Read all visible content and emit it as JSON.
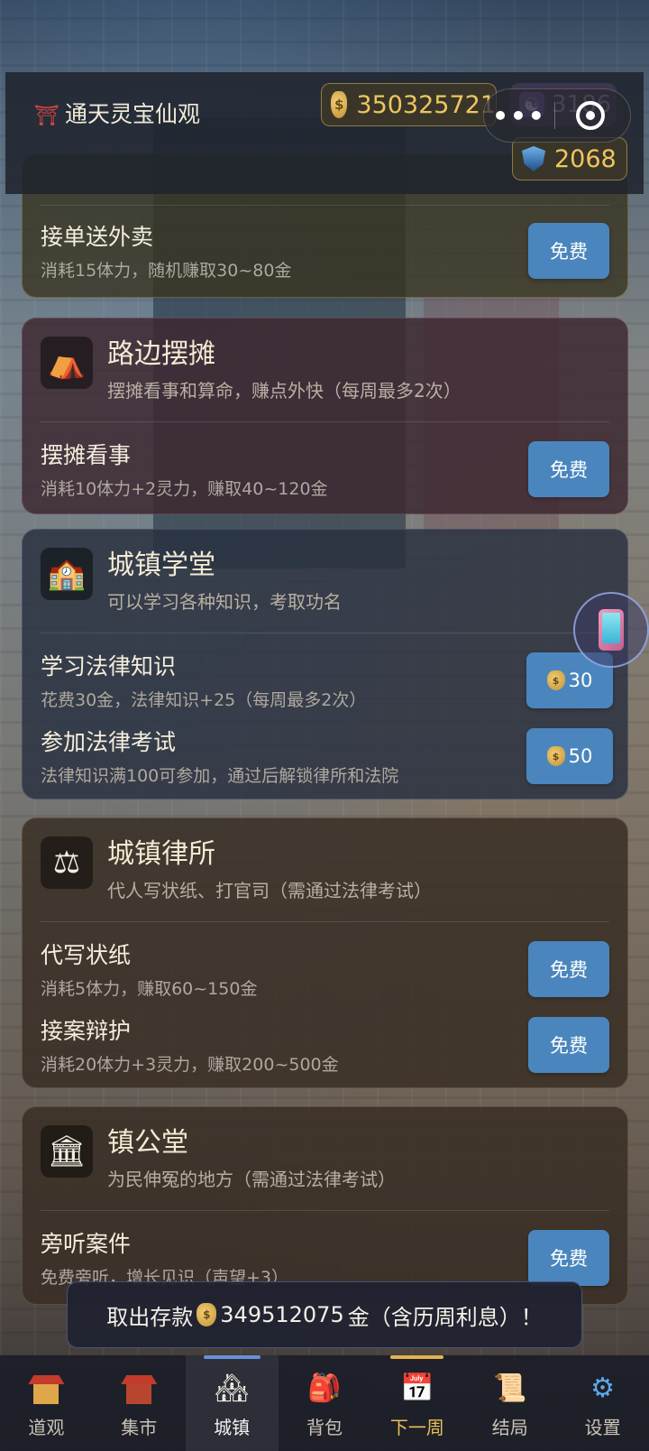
{
  "header": {
    "location": "通天灵宝仙观",
    "gold": "350325721",
    "spirit": "3186",
    "reputation": "2068"
  },
  "cards": [
    {
      "rows": [
        {
          "name": "接单送外卖",
          "desc": "消耗15体力，随机赚取30~80金",
          "button": "免费"
        }
      ]
    },
    {
      "title": "路边摆摊",
      "subtitle": "摆摊看事和算命，赚点外快（每周最多2次）",
      "icon": "tent-icon",
      "rows": [
        {
          "name": "摆摊看事",
          "desc": "消耗10体力+2灵力，赚取40~120金",
          "button": "免费"
        }
      ]
    },
    {
      "title": "城镇学堂",
      "subtitle": "可以学习各种知识，考取功名",
      "icon": "school-icon",
      "rows": [
        {
          "name": "学习法律知识",
          "desc": "花费30金，法律知识+25（每周最多2次）",
          "button": "30"
        },
        {
          "name": "参加法律考试",
          "desc": "法律知识满100可参加，通过后解锁律所和法院",
          "button": "50"
        }
      ]
    },
    {
      "title": "城镇律所",
      "subtitle": "代人写状纸、打官司（需通过法律考试）",
      "icon": "scales-icon",
      "rows": [
        {
          "name": "代写状纸",
          "desc": "消耗5体力，赚取60~150金",
          "button": "免费"
        },
        {
          "name": "接案辩护",
          "desc": "消耗20体力+3灵力，赚取200~500金",
          "button": "免费"
        }
      ]
    },
    {
      "title": "镇公堂",
      "subtitle": "为民伸冤的地方（需通过法律考试）",
      "icon": "courthouse-icon",
      "rows": [
        {
          "name": "旁听案件",
          "desc": "免费旁听，增长见识（声望+3）",
          "button": "免费"
        }
      ]
    }
  ],
  "toast": {
    "prefix": "取出存款",
    "amount": "349512075",
    "suffix": "金（含历周利息）！"
  },
  "nav": [
    {
      "label": "道观",
      "icon": "temple-icon"
    },
    {
      "label": "集市",
      "icon": "market-icon"
    },
    {
      "label": "城镇",
      "icon": "town-icon"
    },
    {
      "label": "背包",
      "icon": "backpack-icon"
    },
    {
      "label": "下一周",
      "icon": "calendar-icon"
    },
    {
      "label": "结局",
      "icon": "scroll-icon"
    },
    {
      "label": "设置",
      "icon": "gear-icon"
    }
  ],
  "colors": {
    "gold_text": "#efc560",
    "button_blue": "#4a86bd",
    "active_tab": "#6a8fd8",
    "next_week": "#e9bf58"
  }
}
